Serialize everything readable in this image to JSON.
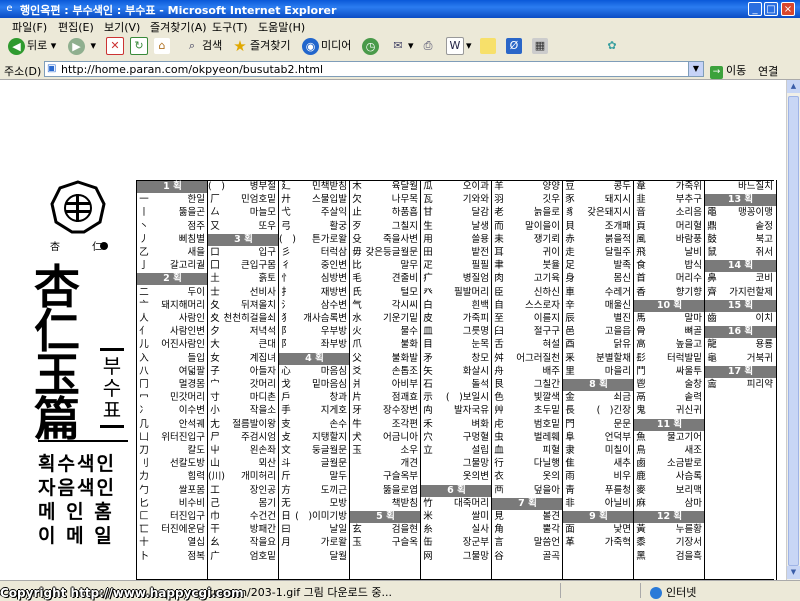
{
  "window": {
    "title": "행인옥편 : 부수색인 : 부수표 - Microsoft Internet Explorer",
    "icon": "ie-icon"
  },
  "menu": [
    "파일(F)",
    "편집(E)",
    "보기(V)",
    "즐겨찾기(A)",
    "도구(T)",
    "도움말(H)"
  ],
  "toolbar": {
    "back": "뒤로",
    "search": "검색",
    "favorites": "즐겨찾기",
    "media": "미디어"
  },
  "address": {
    "label": "주소(D)",
    "url": "http://home.paran.com/okpyeon/busutab2.html",
    "go": "이동",
    "links": "연결"
  },
  "status": {
    "text": "okpyeon/203-1.gif 그림 다운로드 중...",
    "zone": "인터넷"
  },
  "watermark": "Copyright   http://www.happycgi.com",
  "page": {
    "logo_glyphs": [
      "杏",
      "仁"
    ],
    "title_chars": [
      "杏",
      "仁",
      "玉",
      "篇"
    ],
    "subtitle": "부수표",
    "menu_items": [
      "획수색인",
      "자음색인",
      "메 인 홈",
      "이 메 일"
    ],
    "columns": [
      [
        {
          "h": "1 획"
        },
        [
          "一",
          "한일"
        ],
        [
          "丨",
          "뚫을곤"
        ],
        [
          "丶",
          "점주"
        ],
        [
          "丿",
          "삐침별"
        ],
        [
          "乙",
          "새을"
        ],
        [
          "亅",
          "갈고리궐"
        ],
        {
          "h": "2 획"
        },
        [
          "二",
          "두이"
        ],
        [
          "亠",
          "돼지해머리"
        ],
        [
          "人",
          "사람인"
        ],
        [
          "亻",
          "사람인변"
        ],
        [
          "儿",
          "어진사람인"
        ],
        [
          "入",
          "들입"
        ],
        [
          "八",
          "여덟팔"
        ],
        [
          "冂",
          "멀경몸"
        ],
        [
          "冖",
          "민갓머리"
        ],
        [
          "冫",
          "이수변"
        ],
        [
          "几",
          "안석궤"
        ],
        [
          "凵",
          "위터진입구"
        ],
        [
          "刀",
          "칼도"
        ],
        [
          "刂",
          "선칼도방"
        ],
        [
          "力",
          "힘력"
        ],
        [
          "勹",
          "쌀포몸"
        ],
        [
          "匕",
          "비수비"
        ],
        [
          "匚",
          "터진입구"
        ],
        [
          "匸",
          "터진에운담"
        ],
        [
          "十",
          "열십"
        ],
        [
          "卜",
          "점복"
        ]
      ],
      [
        [
          "(　)",
          "병부절"
        ],
        [
          "厂",
          "민엄호밑"
        ],
        [
          "厶",
          "마늘모"
        ],
        [
          "又",
          "또우"
        ],
        {
          "h": "3 획"
        },
        [
          "口",
          "입구"
        ],
        [
          "囗",
          "큰입구몸"
        ],
        [
          "土",
          "흙토"
        ],
        [
          "士",
          "선비사"
        ],
        [
          "夂",
          "뒤져올치"
        ],
        [
          "夊",
          "천천히걸을쇠"
        ],
        [
          "夕",
          "저녁석"
        ],
        [
          "大",
          "큰대"
        ],
        [
          "女",
          "계집녀"
        ],
        [
          "子",
          "아들자"
        ],
        [
          "宀",
          "갓머리"
        ],
        [
          "寸",
          "마디촌"
        ],
        [
          "小",
          "작을소"
        ],
        [
          "尢",
          "절름발이왕"
        ],
        [
          "尸",
          "주검시엄"
        ],
        [
          "屮",
          "왼손좌"
        ],
        [
          "山",
          "뫼산"
        ],
        [
          "(川)",
          "개미허리"
        ],
        [
          "工",
          "장인공"
        ],
        [
          "己",
          "몸기"
        ],
        [
          "巾",
          "수건건"
        ],
        [
          "干",
          "방패간"
        ],
        [
          "幺",
          "작을요"
        ],
        [
          "广",
          "엄호밑"
        ]
      ],
      [
        [
          "廴",
          "민책받침"
        ],
        [
          "廾",
          "스물입발"
        ],
        [
          "弋",
          "주살익"
        ],
        [
          "弓",
          "활궁"
        ],
        [
          "(　)",
          "튼가로왈"
        ],
        [
          "彡",
          "터럭삼"
        ],
        [
          "彳",
          "중인변"
        ],
        [
          "忄",
          "심방변"
        ],
        [
          "扌",
          "재방변"
        ],
        [
          "氵",
          "삼수변"
        ],
        [
          "犭",
          "개사슴록변"
        ],
        [
          "阝",
          "우부방"
        ],
        [
          "阝",
          "좌부방"
        ],
        {
          "h": "4 획"
        },
        [
          "心",
          "마음심"
        ],
        [
          "戈",
          "밑마음심"
        ],
        [
          "戶",
          "창과"
        ],
        [
          "手",
          "지게호"
        ],
        [
          "支",
          "손수"
        ],
        [
          "攴",
          "지탱할지"
        ],
        [
          "文",
          "둥글월문"
        ],
        [
          "斗",
          "글월문"
        ],
        [
          "斤",
          "말두"
        ],
        [
          "方",
          "도끼근"
        ],
        [
          "无",
          "모방"
        ],
        [
          "日",
          "(　)이미기방"
        ],
        [
          "曰",
          "날일"
        ],
        [
          "月",
          "가로왈"
        ],
        [
          "",
          "달월"
        ]
      ],
      [
        [
          "木",
          "육달월"
        ],
        [
          "欠",
          "나무목"
        ],
        [
          "止",
          "하품흠"
        ],
        [
          "歹",
          "그칠지"
        ],
        [
          "殳",
          "죽을사변"
        ],
        [
          "毋",
          "갖은등글월문"
        ],
        [
          "比",
          "말무"
        ],
        [
          "毛",
          "견줄비"
        ],
        [
          "氏",
          "털모"
        ],
        [
          "气",
          "각시씨"
        ],
        [
          "水",
          "기운기밑"
        ],
        [
          "火",
          "물수"
        ],
        [
          "爪",
          "불화"
        ],
        [
          "父",
          "불화발"
        ],
        [
          "爻",
          "손톱조"
        ],
        [
          "爿",
          "아비부"
        ],
        [
          "片",
          "점괘효"
        ],
        [
          "牙",
          "장수장변"
        ],
        [
          "牛",
          "조각편"
        ],
        [
          "犬",
          "어금니아"
        ],
        [
          "玉",
          "소우"
        ],
        [
          "",
          "개견"
        ],
        [
          "",
          "구슬옥부"
        ],
        [
          "",
          "뚫을로엽"
        ],
        [
          "",
          "책받침"
        ],
        {
          "h": "5 획"
        },
        [
          "玄",
          "검을현"
        ],
        [
          "玉",
          "구슬옥"
        ]
      ],
      [
        [
          "瓜",
          "오이과"
        ],
        [
          "瓦",
          "기와와"
        ],
        [
          "甘",
          "달감"
        ],
        [
          "生",
          "날생"
        ],
        [
          "用",
          "쓸용"
        ],
        [
          "田",
          "밭전"
        ],
        [
          "疋",
          "필필"
        ],
        [
          "疒",
          "병질엄"
        ],
        [
          "癶",
          "필발머리"
        ],
        [
          "白",
          "흰백"
        ],
        [
          "皮",
          "가죽피"
        ],
        [
          "皿",
          "그릇명"
        ],
        [
          "目",
          "눈목"
        ],
        [
          "矛",
          "창모"
        ],
        [
          "矢",
          "화살시"
        ],
        [
          "石",
          "돌석"
        ],
        [
          "示",
          "(　)보일시"
        ],
        [
          "禸",
          "발자국유"
        ],
        [
          "禾",
          "벼화"
        ],
        [
          "穴",
          "구멍혈"
        ],
        [
          "立",
          "설립"
        ],
        [
          "",
          "그물망"
        ],
        [
          "",
          "옷의변"
        ],
        {
          "h": "6 획"
        },
        [
          "竹",
          "대죽머리"
        ],
        [
          "米",
          "쌀미"
        ],
        [
          "糸",
          "실사"
        ],
        [
          "缶",
          "장군부"
        ],
        [
          "网",
          "그물망"
        ]
      ],
      [
        [
          "羊",
          "양양"
        ],
        [
          "羽",
          "깃우"
        ],
        [
          "老",
          "늙을로"
        ],
        [
          "而",
          "말이을이"
        ],
        [
          "耒",
          "쟁기뢰"
        ],
        [
          "耳",
          "귀이"
        ],
        [
          "聿",
          "붓율"
        ],
        [
          "肉",
          "고기육"
        ],
        [
          "臣",
          "신하신"
        ],
        [
          "自",
          "스스로자"
        ],
        [
          "至",
          "이를지"
        ],
        [
          "臼",
          "절구구"
        ],
        [
          "舌",
          "혀설"
        ],
        [
          "舛",
          "어그러질천"
        ],
        [
          "舟",
          "배주"
        ],
        [
          "艮",
          "그칠간"
        ],
        [
          "色",
          "빛깔색"
        ],
        [
          "艸",
          "초두밑"
        ],
        [
          "虍",
          "범호밑"
        ],
        [
          "虫",
          "벌레훼"
        ],
        [
          "血",
          "피혈"
        ],
        [
          "行",
          "다닐행"
        ],
        [
          "衣",
          "옷의"
        ],
        [
          "襾",
          "덮을아"
        ],
        {
          "h": "7 획"
        },
        [
          "見",
          "볼견"
        ],
        [
          "角",
          "뿔각"
        ],
        [
          "言",
          "말씀언"
        ],
        [
          "谷",
          "골곡"
        ]
      ],
      [
        [
          "豆",
          "콩두"
        ],
        [
          "豕",
          "돼지시"
        ],
        [
          "豸",
          "갖은돼지시"
        ],
        [
          "貝",
          "조개패"
        ],
        [
          "赤",
          "붉을적"
        ],
        [
          "走",
          "달릴주"
        ],
        [
          "足",
          "발족"
        ],
        [
          "身",
          "몸신"
        ],
        [
          "車",
          "수레거"
        ],
        [
          "辛",
          "매울신"
        ],
        [
          "辰",
          "별진"
        ],
        [
          "邑",
          "고을읍"
        ],
        [
          "酉",
          "닭유"
        ],
        [
          "釆",
          "분별할채"
        ],
        [
          "里",
          "마을리"
        ],
        {
          "h": "8 획"
        },
        [
          "金",
          "쇠금"
        ],
        [
          "長",
          "(　)긴장"
        ],
        [
          "門",
          "문문"
        ],
        [
          "阜",
          "언덕부"
        ],
        [
          "隶",
          "미칠이"
        ],
        [
          "隹",
          "새추"
        ],
        [
          "雨",
          "비우"
        ],
        [
          "靑",
          "푸를청"
        ],
        [
          "非",
          "아닐비"
        ],
        {
          "h": "9 획"
        },
        [
          "面",
          "낯면"
        ],
        [
          "革",
          "가죽혁"
        ]
      ],
      [
        [
          "韋",
          "가죽위"
        ],
        [
          "韭",
          "부추구"
        ],
        [
          "音",
          "소리음"
        ],
        [
          "頁",
          "머리혈"
        ],
        [
          "風",
          "바람풍"
        ],
        [
          "飛",
          "날비"
        ],
        [
          "食",
          "밥식"
        ],
        [
          "首",
          "머리수"
        ],
        [
          "香",
          "향기향"
        ],
        {
          "h": "10 획"
        },
        [
          "馬",
          "말마"
        ],
        [
          "骨",
          "뼈골"
        ],
        [
          "高",
          "높을고"
        ],
        [
          "髟",
          "터럭발밑"
        ],
        [
          "鬥",
          "싸울투"
        ],
        [
          "鬯",
          "술창"
        ],
        [
          "鬲",
          "솥력"
        ],
        [
          "鬼",
          "귀신귀"
        ],
        {
          "h": "11 획"
        },
        [
          "魚",
          "물고기어"
        ],
        [
          "鳥",
          "새조"
        ],
        [
          "鹵",
          "소금밭로"
        ],
        [
          "鹿",
          "사슴록"
        ],
        [
          "麥",
          "보리맥"
        ],
        [
          "麻",
          "삼마"
        ],
        {
          "h": "12 획"
        },
        [
          "黃",
          "누를황"
        ],
        [
          "黍",
          "기장서"
        ],
        [
          "黑",
          "검을흑"
        ]
      ],
      [
        [
          "",
          "바느질치"
        ],
        {
          "h": "13 획"
        },
        [
          "黽",
          "맹꽁이맹"
        ],
        [
          "鼎",
          "솥정"
        ],
        [
          "鼓",
          "북고"
        ],
        [
          "鼠",
          "쥐서"
        ],
        {
          "h": "14 획"
        },
        [
          "鼻",
          "코비"
        ],
        [
          "齊",
          "가지런할제"
        ],
        {
          "h": "15 획"
        },
        [
          "齒",
          "이치"
        ],
        {
          "h": "16 획"
        },
        [
          "龍",
          "용룡"
        ],
        [
          "龜",
          "거북귀"
        ],
        {
          "h": "17 획"
        },
        [
          "龠",
          "피리약"
        ]
      ]
    ]
  }
}
